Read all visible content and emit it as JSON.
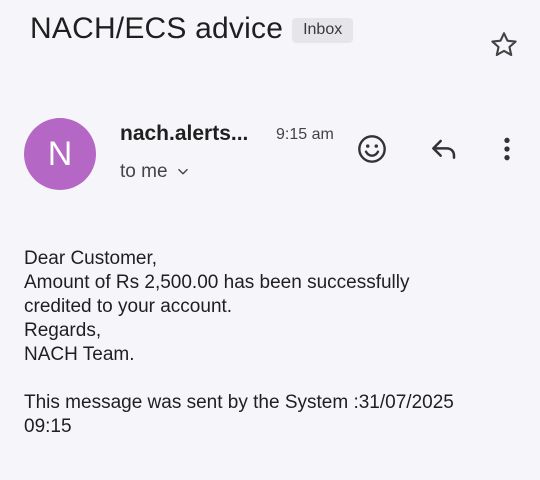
{
  "email": {
    "subject": "NACH/ECS advice",
    "label": "Inbox",
    "sender": {
      "avatar_letter": "N",
      "avatar_color": "#b467c4",
      "name": "nach.alerts...",
      "time": "9:15 am",
      "recipient": "to me"
    },
    "body": {
      "greeting": "Dear Customer,",
      "line1": "Amount of Rs 2,500.00 has been successfully",
      "line2": "credited to your account.",
      "sign_off": "Regards,",
      "team": "NACH Team.",
      "footer_line1": "This message was sent by the System :31/07/2025",
      "footer_line2": "09:15"
    }
  },
  "icons": {
    "star": "star-outline-icon",
    "expand": "chevron-down-icon",
    "emoji": "add-reaction-icon",
    "reply": "reply-icon",
    "more": "more-vert-icon"
  }
}
